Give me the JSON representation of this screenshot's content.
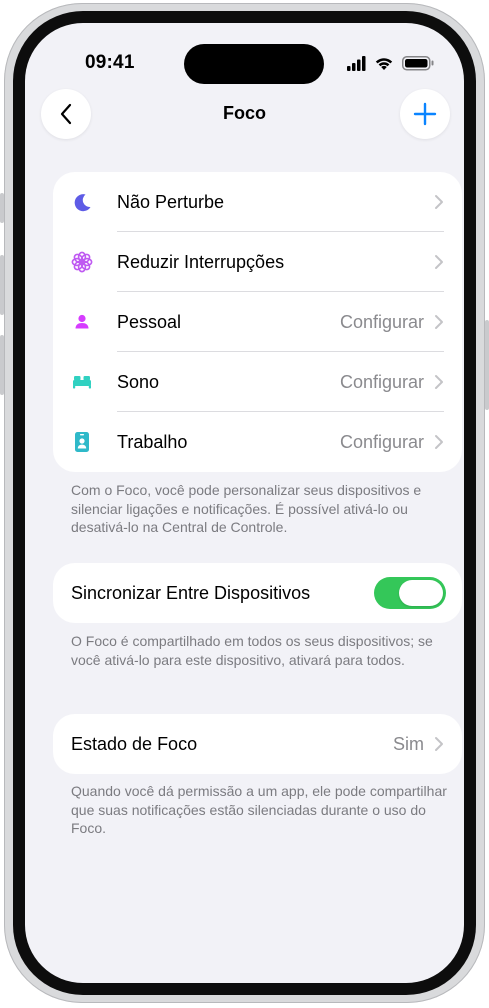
{
  "status_bar": {
    "time": "09:41",
    "icons": [
      "cellular-signal-icon",
      "wifi-icon",
      "battery-icon"
    ]
  },
  "nav": {
    "title": "Foco",
    "back_icon": "chevron-left-icon",
    "add_icon": "plus-icon"
  },
  "focus_modes": [
    {
      "label": "Não Perturbe",
      "value": "",
      "icon": "moon-icon",
      "color": "#5e5ce6"
    },
    {
      "label": "Reduzir Interrupções",
      "value": "",
      "icon": "flower-icon",
      "color": "#bf5af2"
    },
    {
      "label": "Pessoal",
      "value": "Configurar",
      "icon": "person-icon",
      "color": "#d63cff"
    },
    {
      "label": "Sono",
      "value": "Configurar",
      "icon": "bed-icon",
      "color": "#30d1c1"
    },
    {
      "label": "Trabalho",
      "value": "Configurar",
      "icon": "badge-icon",
      "color": "#2fb9c9"
    }
  ],
  "focus_footnote": "Com o Foco, você pode personalizar seus dispositivos e silenciar ligações e notificações. É possível ativá-lo ou desativá-lo na Central de Controle.",
  "sync": {
    "label": "Sincronizar Entre Dispositivos",
    "enabled": true,
    "footnote": "O Foco é compartilhado em todos os seus dispositivos; se você ativá-lo para este dispositivo, ativará para todos."
  },
  "focus_status": {
    "label": "Estado de Foco",
    "value": "Sim",
    "footnote": "Quando você dá permissão a um app, ele pode compartilhar que suas notificações estão silenciadas durante o uso do Foco."
  },
  "colors": {
    "accent_blue": "#0a84ff",
    "toggle_on": "#34c759",
    "background": "#f2f2f7"
  }
}
